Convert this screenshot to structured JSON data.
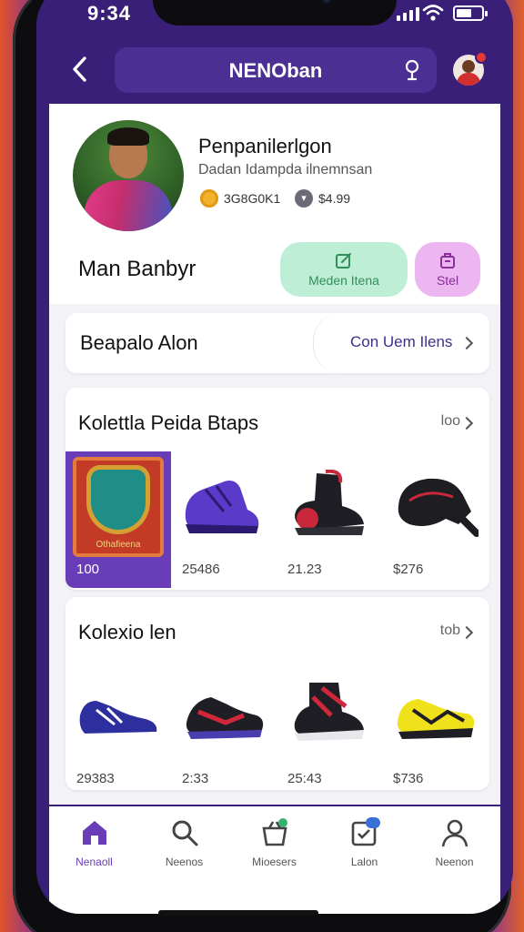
{
  "status": {
    "time": "9:34"
  },
  "header": {
    "title": "NENOban"
  },
  "profile": {
    "name": "Penpanilerlgon",
    "subtitle": "Dadan Idampda ilnemnsan",
    "coins": "3G8G0K1",
    "gems": "$4.99",
    "owner_name": "Man Banbyr",
    "btn_green_label": "Meden Itena",
    "btn_pink_label": "Stel"
  },
  "banner": {
    "left_label": "Beapalo Alon",
    "right_label": "Con Uem Ilens"
  },
  "section1": {
    "title": "Kolettla Peida Btaps",
    "more": "loo",
    "items": [
      {
        "price": "100",
        "caption": "Othafieena"
      },
      {
        "price": "25486"
      },
      {
        "price": "21.23"
      },
      {
        "price": "$276"
      }
    ]
  },
  "section2": {
    "title": "Kolexio len",
    "more": "tob",
    "items": [
      {
        "price": "29383"
      },
      {
        "price": "2:33"
      },
      {
        "price": "25:43"
      },
      {
        "price": "$736"
      }
    ]
  },
  "tabs": [
    {
      "label": "Nenaoll",
      "icon": "home-icon"
    },
    {
      "label": "Neenos",
      "icon": "search-icon"
    },
    {
      "label": "Mioesers",
      "icon": "basket-icon"
    },
    {
      "label": "Lalon",
      "icon": "calendar-icon"
    },
    {
      "label": "Neenon",
      "icon": "user-icon"
    }
  ],
  "colors": {
    "accent": "#6a3db8",
    "header_bg": "#3a1f78",
    "green": "#bfeed6",
    "pink": "#ecb6f0"
  }
}
